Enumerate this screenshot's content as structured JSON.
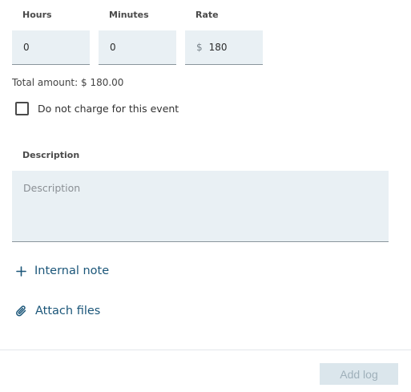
{
  "fields": {
    "hours": {
      "label": "Hours",
      "value": "0"
    },
    "minutes": {
      "label": "Minutes",
      "value": "0"
    },
    "rate": {
      "label": "Rate",
      "prefix": "$",
      "value": "180"
    }
  },
  "total_amount": "Total amount: $ 180.00",
  "no_charge": {
    "label": "Do not charge for this event",
    "checked": false
  },
  "description": {
    "label": "Description",
    "placeholder": "Description"
  },
  "actions": {
    "internal_note": {
      "label": "Internal note",
      "icon": "plus-icon"
    },
    "attach_files": {
      "label": "Attach files",
      "icon": "paperclip-icon"
    }
  },
  "footer": {
    "add_log_label": "Add log",
    "add_log_disabled": true
  },
  "colors": {
    "input_bg": "#e9f0f4",
    "link": "#1b5679",
    "button_disabled_bg": "#dbe6ec",
    "button_disabled_text": "#9fb0ba"
  }
}
